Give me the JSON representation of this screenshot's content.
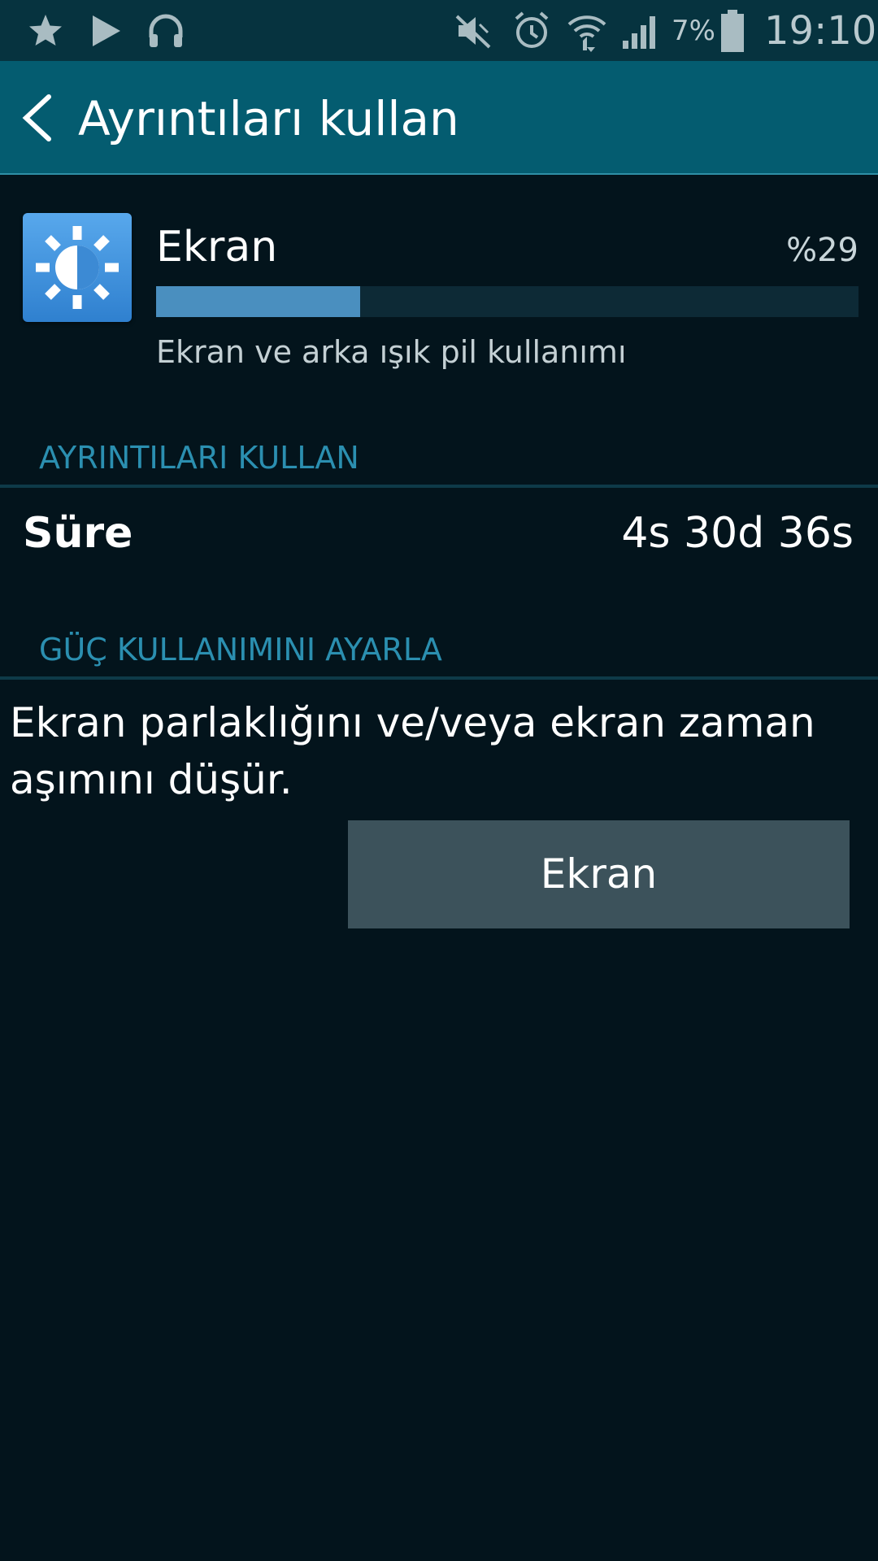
{
  "status_bar": {
    "left_icons": [
      "star-icon",
      "play-store-icon",
      "headphones-icon"
    ],
    "right_icons": [
      "mute-icon",
      "alarm-icon",
      "wifi-icon",
      "signal-icon",
      "battery-icon"
    ],
    "battery_percent": "7%",
    "battery_level": 0.07,
    "time": "19:10"
  },
  "action_bar": {
    "back_icon": "chevron-left-icon",
    "title": "Ayrıntıları kullan"
  },
  "app": {
    "icon": "brightness-icon",
    "icon_color": "#3d8fdc",
    "name": "Ekran",
    "usage_percent_label": "%29",
    "usage_fraction": 0.29,
    "bar_color": "#4a8fbf",
    "description": "Ekran ve arka ışık pil kullanımı"
  },
  "usage_details": {
    "header": "AYRINTILARI KULLAN",
    "duration_label": "Süre",
    "duration_value": "4s 30d 36s"
  },
  "power_adjust": {
    "header": "GÜÇ KULLANIMINI AYARLA",
    "tip": "Ekran parlaklığını ve/veya ekran zaman aşımını düşür.",
    "button_label": "Ekran"
  },
  "colors": {
    "background": "#03141c",
    "status_bar": "#06333f",
    "action_bar": "#045c70",
    "section_header": "#2b8fb0",
    "button": "#3c525b"
  }
}
